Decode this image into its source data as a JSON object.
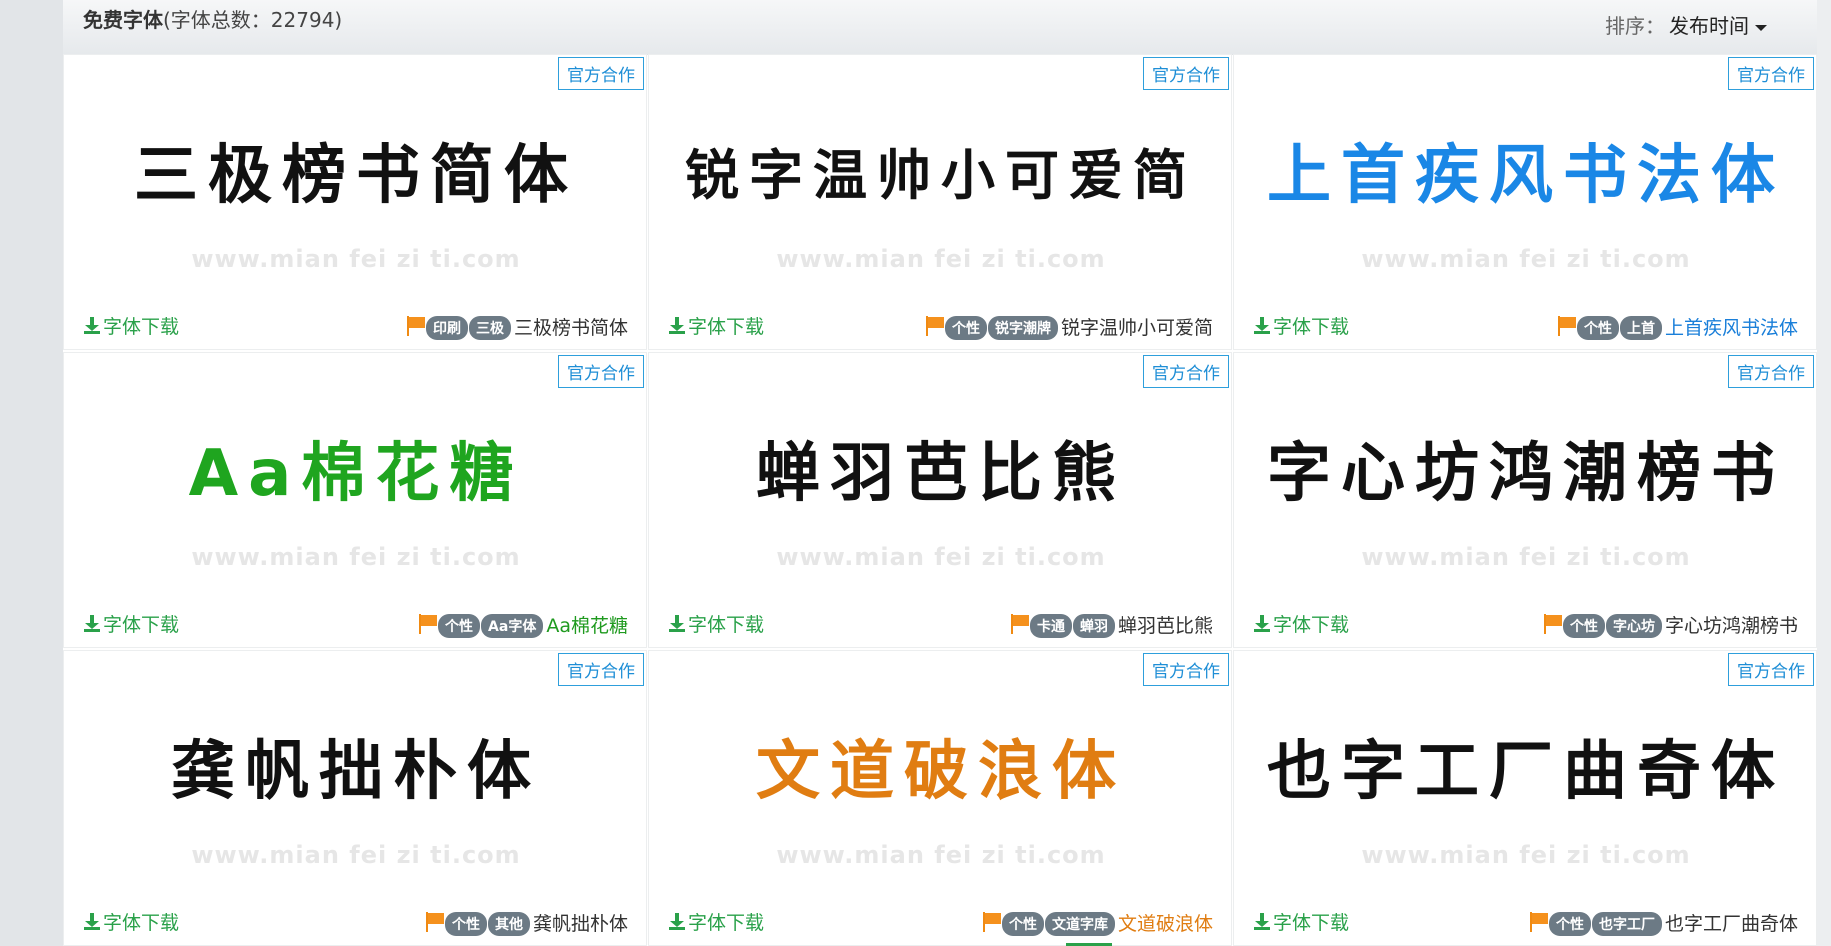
{
  "header": {
    "title": "免费字体",
    "count_text": "(字体总数：22794)",
    "sort_label": "排序：",
    "sort_value": "发布时间"
  },
  "download_label": "字体下载",
  "badge_label": "官方合作",
  "watermark": "www.mian fei zi ti.com",
  "cards": [
    {
      "preview": "三极榜书简体",
      "preview_color": "#111111",
      "tags": [
        "印刷",
        "三极"
      ],
      "name": "三极榜书简体",
      "name_color": "#333333"
    },
    {
      "preview": "锐字温帅小可爱简",
      "preview_color": "#111111",
      "tags": [
        "个性",
        "锐字潮牌"
      ],
      "name": "锐字温帅小可爱简",
      "name_color": "#333333"
    },
    {
      "preview": "上首疾风书法体",
      "preview_color": "#1a87e6",
      "tags": [
        "个性",
        "上首"
      ],
      "name": "上首疾风书法体",
      "name_color": "#1a7fd9"
    },
    {
      "preview": "Aa棉花糖",
      "preview_color": "#1fa51f",
      "tags": [
        "个性",
        "Aa字体"
      ],
      "name": "Aa棉花糖",
      "name_color": "#1f9a1f"
    },
    {
      "preview": "蝉羽芭比熊",
      "preview_color": "#111111",
      "tags": [
        "卡通",
        "蝉羽"
      ],
      "name": "蝉羽芭比熊",
      "name_color": "#333333"
    },
    {
      "preview": "字心坊鸿潮榜书",
      "preview_color": "#111111",
      "tags": [
        "个性",
        "字心坊"
      ],
      "name": "字心坊鸿潮榜书",
      "name_color": "#333333"
    },
    {
      "preview": "龚帆拙朴体",
      "preview_color": "#111111",
      "tags": [
        "个性",
        "其他"
      ],
      "name": "龚帆拙朴体",
      "name_color": "#333333"
    },
    {
      "preview": "文道破浪体",
      "preview_color": "#e07d12",
      "tags": [
        "个性",
        "文道字库"
      ],
      "name": "文道破浪体",
      "name_color": "#e07d12"
    },
    {
      "preview": "也字工厂曲奇体",
      "preview_color": "#111111",
      "tags": [
        "个性",
        "也字工厂"
      ],
      "name": "也字工厂曲奇体",
      "name_color": "#333333"
    }
  ]
}
